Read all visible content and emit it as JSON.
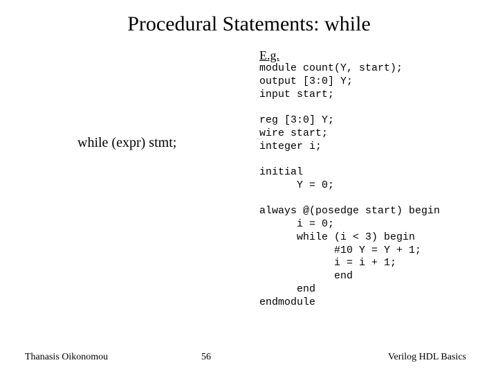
{
  "title": "Procedural Statements: while",
  "eg_label": "E.g.",
  "syntax": "while (expr) stmt;",
  "code": "module count(Y, start);\noutput [3:0] Y;\ninput start;\n\nreg [3:0] Y;\nwire start;\ninteger i;\n\ninitial\n      Y = 0;\n\nalways @(posedge start) begin\n      i = 0;\n      while (i < 3) begin\n            #10 Y = Y + 1;\n            i = i + 1;\n            end\n      end\nendmodule",
  "footer": {
    "left": "Thanasis Oikonomou",
    "center": "56",
    "right": "Verilog HDL Basics"
  }
}
